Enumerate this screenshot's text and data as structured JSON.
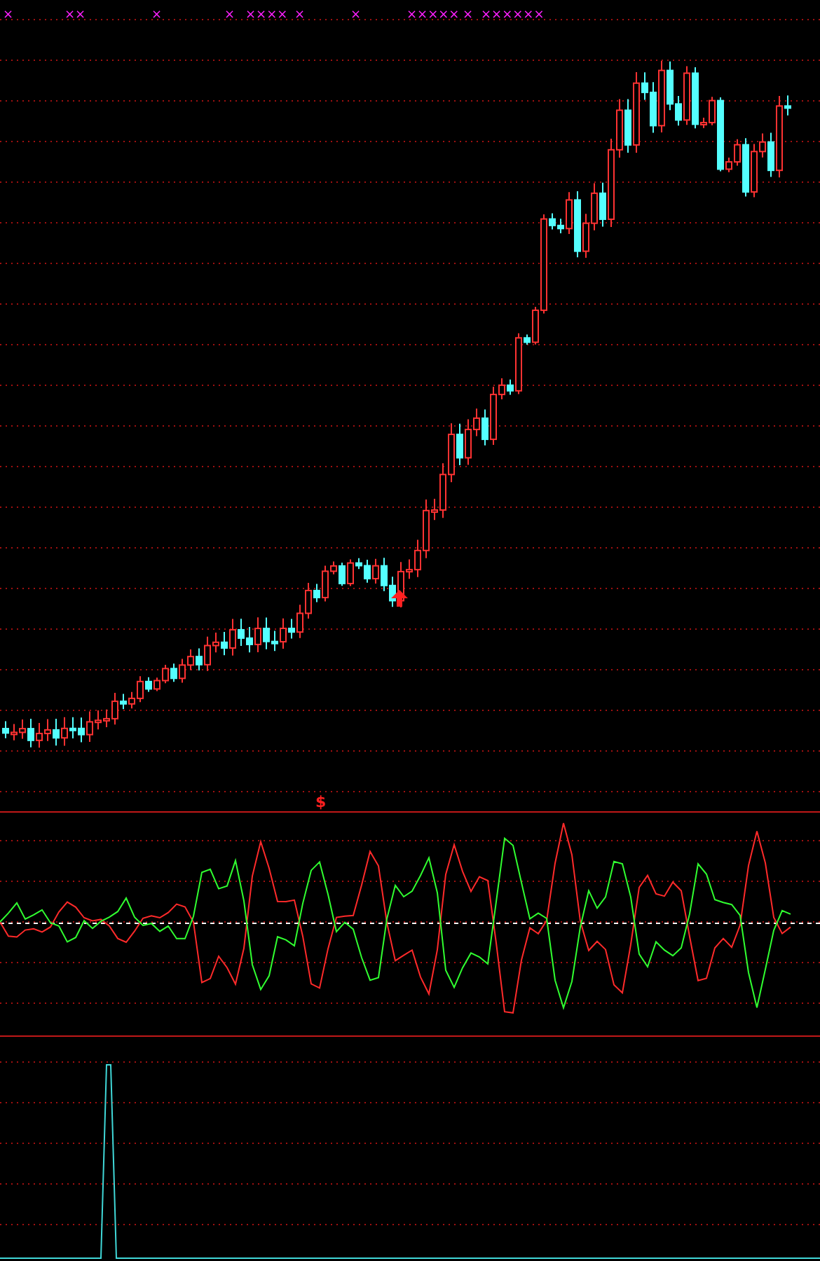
{
  "top_signal_marks": [
    "×",
    "××",
    "×",
    "×",
    "××××",
    "×",
    "×",
    "×××××",
    "×",
    "××××××"
  ],
  "panels": [
    {
      "kind": "candlestick"
    },
    {
      "kind": "oscillator",
      "marker": "$"
    },
    {
      "kind": "spike"
    }
  ]
}
